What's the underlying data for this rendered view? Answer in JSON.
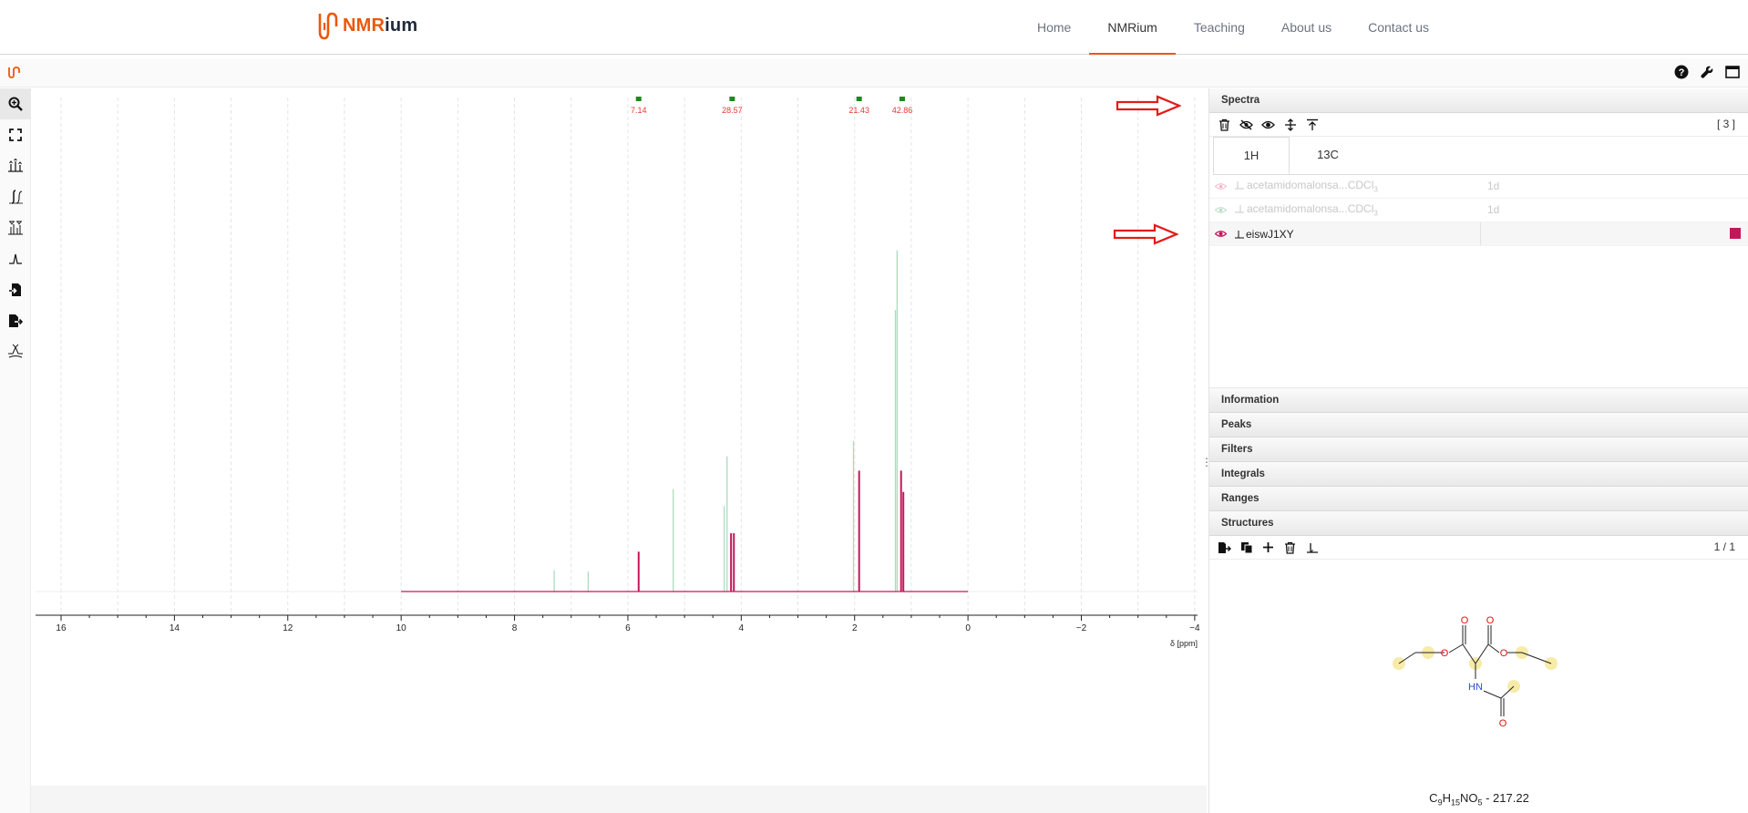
{
  "site": {
    "logo_text_1": "NMR",
    "logo_text_2": "ium",
    "nav": [
      "Home",
      "NMRium",
      "Teaching",
      "About us",
      "Contact us"
    ],
    "active_nav": "NMRium"
  },
  "header_icons": [
    "help-icon",
    "wrench-icon",
    "fullscreen-icon"
  ],
  "toolbar_icons": [
    "zoom-icon",
    "full-zoom-out-icon",
    "peak-picking-icon",
    "integral-icon",
    "range-picking-icon",
    "zero-filling-icon",
    "import-icon",
    "export-icon",
    "baseline-correction-icon"
  ],
  "spectrum_axis": {
    "unit_label": "δ [ppm]",
    "ticks": [
      {
        "value": 16,
        "label": "16"
      },
      {
        "value": 14,
        "label": "14"
      },
      {
        "value": 12,
        "label": "12"
      },
      {
        "value": 10,
        "label": "10"
      },
      {
        "value": 8,
        "label": "8"
      },
      {
        "value": 6,
        "label": "6"
      },
      {
        "value": 4,
        "label": "4"
      },
      {
        "value": 2,
        "label": "2"
      },
      {
        "value": 0,
        "label": "0"
      },
      {
        "value": -2,
        "label": "−2"
      },
      {
        "value": -4,
        "label": "−4"
      }
    ],
    "range": [
      16.45,
      -4.05
    ]
  },
  "integrals": [
    {
      "ppm": 5.81,
      "label": "7.14"
    },
    {
      "ppm": 4.16,
      "label": "28.57"
    },
    {
      "ppm": 1.92,
      "label": "21.43"
    },
    {
      "ppm": 1.16,
      "label": "42.86"
    }
  ],
  "peaks_selected": [
    {
      "ppm": 5.81,
      "height": 0.28
    },
    {
      "ppm": 4.18,
      "height": 0.41
    },
    {
      "ppm": 4.13,
      "height": 0.41
    },
    {
      "ppm": 1.92,
      "height": 0.85
    },
    {
      "ppm": 1.18,
      "height": 0.85
    },
    {
      "ppm": 1.14,
      "height": 0.7
    }
  ],
  "peaks_background": [
    {
      "ppm": 7.3,
      "height": 0.15
    },
    {
      "ppm": 6.7,
      "height": 0.14
    },
    {
      "ppm": 5.2,
      "height": 0.72
    },
    {
      "ppm": 4.25,
      "height": 0.95
    },
    {
      "ppm": 4.3,
      "height": 0.6
    },
    {
      "ppm": 2.02,
      "height": 1.06
    },
    {
      "ppm": 1.28,
      "height": 1.98
    },
    {
      "ppm": 1.25,
      "height": 2.4
    }
  ],
  "panel": {
    "spectra_title": "Spectra",
    "spectra_count": "[ 3 ]",
    "tabs": [
      "1H",
      "13C"
    ],
    "active_tab": "1H",
    "rows": [
      {
        "name": "acetamidomalonsa...CDCl",
        "sub": "3",
        "dim": "1d",
        "state": "dim"
      },
      {
        "name": "acetamidomalonsa...CDCl",
        "sub": "3",
        "dim": "1d",
        "state": "dim"
      },
      {
        "name": "eiswJ1XY",
        "sub": "",
        "dim": "",
        "state": "selected",
        "color": "#c2185b"
      }
    ],
    "sections": [
      "Information",
      "Peaks",
      "Filters",
      "Integrals",
      "Ranges",
      "Structures"
    ],
    "structure_count": "1 / 1",
    "formula": {
      "C": "C",
      "c_n": "9",
      "H": "H",
      "h_n": "15",
      "rest": "NO",
      "o_n": "5",
      "mass": " - 217.22"
    },
    "atoms": {
      "o1": "O",
      "o2": "O",
      "o3": "O",
      "o4": "O",
      "o5": "O",
      "nh": "HN"
    }
  },
  "colors": {
    "accent": "#ea580c",
    "selected_spectrum": "#c2185b",
    "background_spectrum": "#8fd1a6",
    "integral": "#e53935",
    "integral_marker": "#1b8a1b",
    "arrow": "#e31b1b"
  }
}
